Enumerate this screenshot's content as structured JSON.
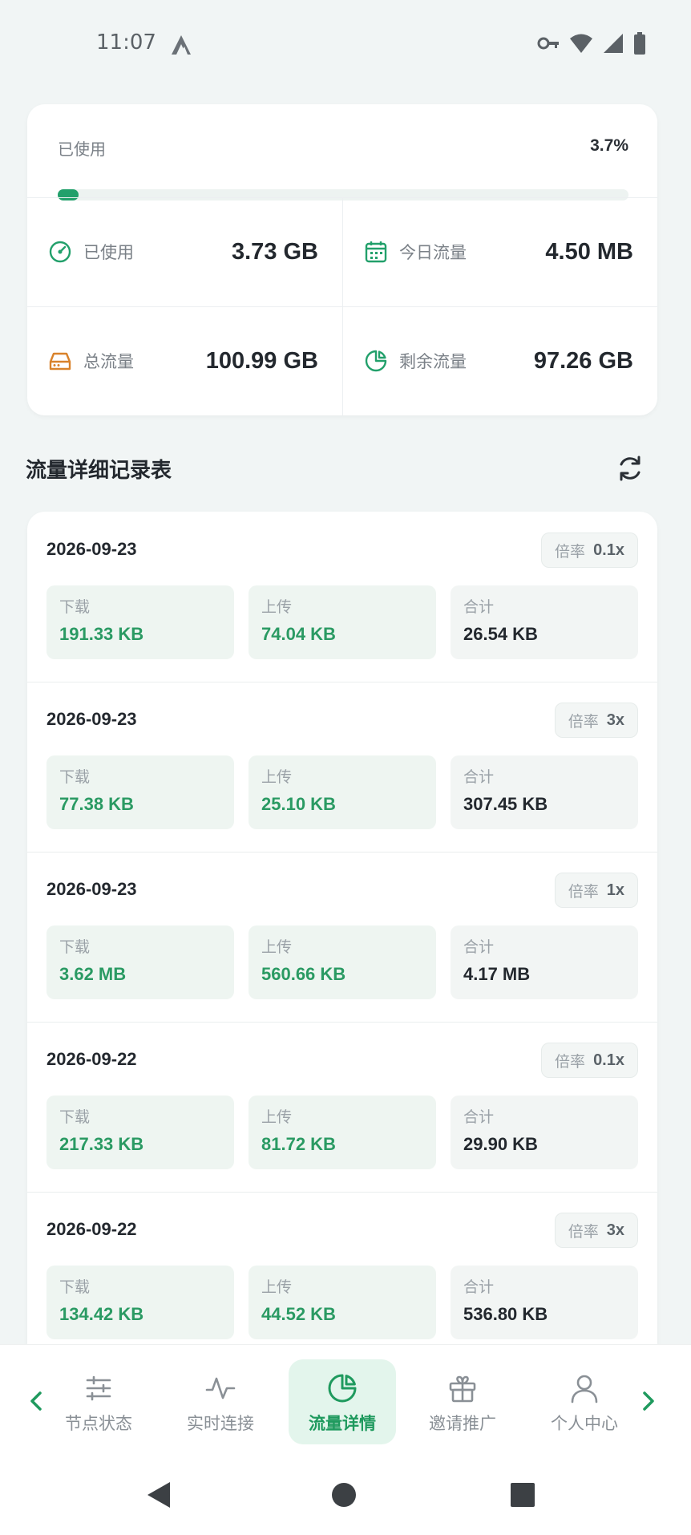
{
  "status_bar": {
    "time": "11:07"
  },
  "summary": {
    "usage_label": "已使用",
    "usage_percent_text": "3.7%",
    "usage_fraction": 0.037,
    "stats": [
      {
        "icon": "gauge-icon",
        "label": "已使用",
        "value": "3.73 GB"
      },
      {
        "icon": "calendar-icon",
        "label": "今日流量",
        "value": "4.50 MB"
      },
      {
        "icon": "hard-drive-icon",
        "label": "总流量",
        "value": "100.99 GB"
      },
      {
        "icon": "pie-chart-icon",
        "label": "剩余流量",
        "value": "97.26 GB"
      }
    ]
  },
  "section": {
    "title": "流量详细记录表",
    "refresh_icon": "refresh-icon"
  },
  "labels": {
    "rate": "倍率",
    "download": "下载",
    "upload": "上传",
    "total": "合计"
  },
  "records": [
    {
      "date": "2026-09-23",
      "rate": "0.1x",
      "download": "191.33 KB",
      "upload": "74.04 KB",
      "total": "26.54 KB"
    },
    {
      "date": "2026-09-23",
      "rate": "3x",
      "download": "77.38 KB",
      "upload": "25.10 KB",
      "total": "307.45 KB"
    },
    {
      "date": "2026-09-23",
      "rate": "1x",
      "download": "3.62 MB",
      "upload": "560.66 KB",
      "total": "4.17 MB"
    },
    {
      "date": "2026-09-22",
      "rate": "0.1x",
      "download": "217.33 KB",
      "upload": "81.72 KB",
      "total": "29.90 KB"
    },
    {
      "date": "2026-09-22",
      "rate": "3x",
      "download": "134.42 KB",
      "upload": "44.52 KB",
      "total": "536.80 KB"
    }
  ],
  "bottom_nav": {
    "items": [
      {
        "label": "节点状态",
        "icon": "sliders-icon",
        "active": false
      },
      {
        "label": "实时连接",
        "icon": "activity-icon",
        "active": false
      },
      {
        "label": "流量详情",
        "icon": "pie-chart-icon",
        "active": true
      },
      {
        "label": "邀请推广",
        "icon": "gift-icon",
        "active": false
      },
      {
        "label": "个人中心",
        "icon": "user-icon",
        "active": false
      }
    ]
  },
  "colors": {
    "accent": "#22a06b",
    "background": "#f1f5f5",
    "card": "#ffffff"
  }
}
